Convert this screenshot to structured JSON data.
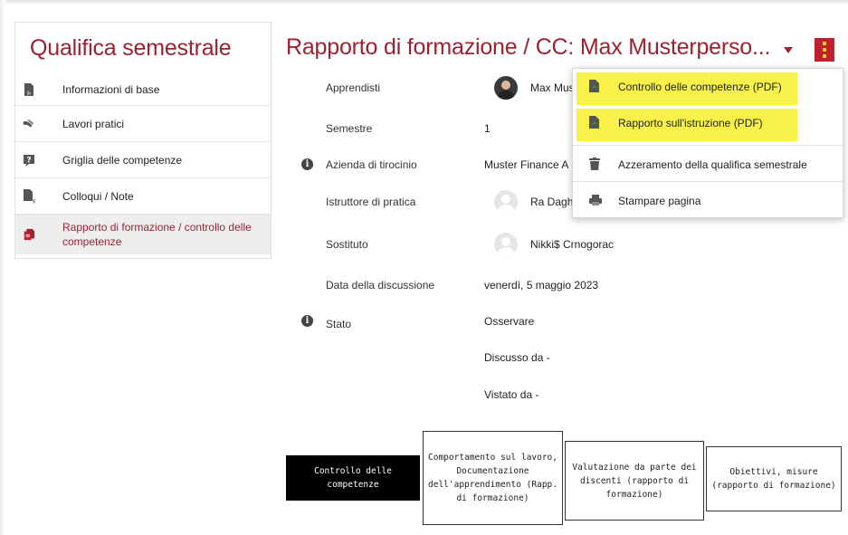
{
  "sidebar": {
    "title": "Qualifica semestrale",
    "items": [
      {
        "label": "Informazioni di base",
        "icon": "document-arrow-icon"
      },
      {
        "label": "Lavori pratici",
        "icon": "hands-icon"
      },
      {
        "label": "Griglia delle competenze",
        "icon": "question-board-icon"
      },
      {
        "label": "Colloqui / Note",
        "icon": "document-note-icon"
      },
      {
        "label": "Rapporto di formazione / controllo delle competenze",
        "icon": "documents-stack-icon",
        "active": true
      }
    ]
  },
  "header": {
    "title": "Rapporto di formazione / CC: Max Musterperso...",
    "caret_icon": "caret-down-icon",
    "menu_icon": "kebab-menu-icon"
  },
  "details": {
    "apprendisti_label": "Apprendisti",
    "apprendisti_value": "Max Mus",
    "semestre_label": "Semestre",
    "semestre_value": "1",
    "azienda_label": "Azienda di tirocinio",
    "azienda_value": "Muster Finance A",
    "istruttore_label": "Istruttore di pratica",
    "istruttore_value": "Ra Daghe",
    "sostituto_label": "Sostituto",
    "sostituto_value": "Nikki$ Crnogorac",
    "data_label": "Data della discussione",
    "data_value": "venerdì, 5 maggio 2023",
    "stato_label": "Stato",
    "stato_value": "Osservare",
    "discusso": "Discusso da -",
    "vistato": "Vistato da -"
  },
  "dropdown": {
    "items": [
      {
        "label": "Controllo delle competenze (PDF)",
        "icon": "pdf-file-icon",
        "highlighted": true
      },
      {
        "label": "Rapporto sull'istruzione (PDF)",
        "icon": "pdf-file-icon",
        "highlighted": true
      },
      {
        "label": "Azzeramento della qualifica semestrale",
        "icon": "trash-icon"
      },
      {
        "label": "Stampare pagina",
        "icon": "printer-icon"
      }
    ]
  },
  "annotations": {
    "box1": "Controllo delle competenze",
    "box2": "Comportamento sul lavoro, Documentazione dell'apprendimento (Rapp. di formazione)",
    "box3": "Valutazione da parte dei discenti (rapporto di formazione)",
    "box4": "Obiettivi, misure (rapporto di formazione)"
  },
  "colors": {
    "brand": "#9b2231",
    "menu_button": "#c0202e",
    "highlight": "#f7f14a"
  }
}
